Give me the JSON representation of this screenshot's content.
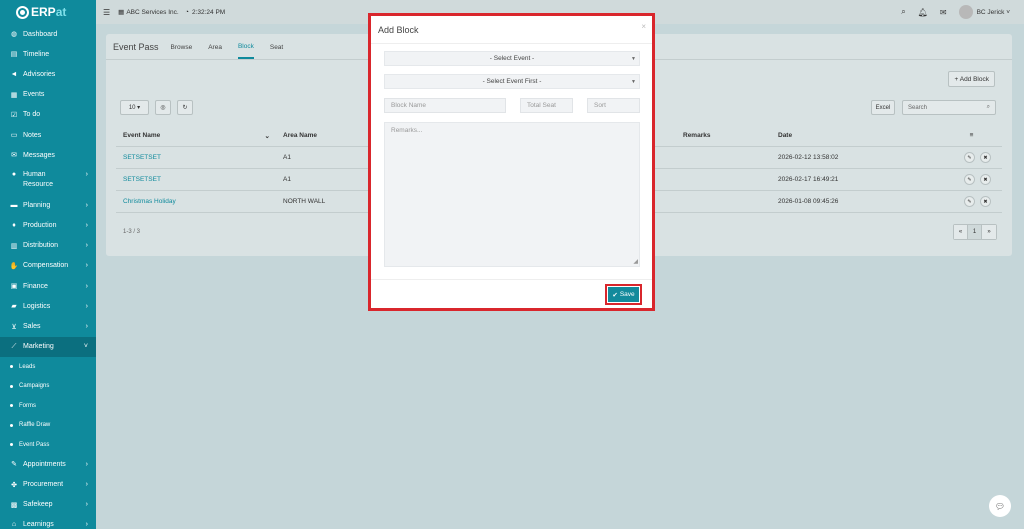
{
  "app": {
    "logo_main": "ERP",
    "logo_accent": "at"
  },
  "topbar": {
    "company": "ABC Services Inc.",
    "time": "2:32:24 PM",
    "user": "BC Jerick"
  },
  "sidebar": {
    "items": [
      {
        "label": "Dashboard",
        "icon": "dashboard-icon"
      },
      {
        "label": "Timeline",
        "icon": "timeline-icon"
      },
      {
        "label": "Advisories",
        "icon": "megaphone-icon"
      },
      {
        "label": "Events",
        "icon": "calendar-icon"
      },
      {
        "label": "To do",
        "icon": "checkbox-icon"
      },
      {
        "label": "Notes",
        "icon": "notes-icon"
      },
      {
        "label": "Messages",
        "icon": "envelope-icon"
      },
      {
        "label": "Human Resource",
        "icon": "users-icon"
      },
      {
        "label": "Planning",
        "icon": "planning-icon"
      },
      {
        "label": "Production",
        "icon": "production-icon"
      },
      {
        "label": "Distribution",
        "icon": "bank-icon"
      },
      {
        "label": "Compensation",
        "icon": "handshake-icon"
      },
      {
        "label": "Finance",
        "icon": "money-icon"
      },
      {
        "label": "Logistics",
        "icon": "truck-icon"
      },
      {
        "label": "Sales",
        "icon": "cart-icon"
      },
      {
        "label": "Marketing",
        "icon": "chart-icon"
      }
    ],
    "sub_items": [
      "Leads",
      "Campaigns",
      "Forms",
      "Raffle Draw",
      "Event Pass"
    ],
    "bottom_items": [
      {
        "label": "Appointments",
        "icon": "edit-icon"
      },
      {
        "label": "Procurement",
        "icon": "procurement-icon"
      },
      {
        "label": "Safekeep",
        "icon": "safe-icon"
      },
      {
        "label": "Learnings",
        "icon": "graduation-icon"
      }
    ]
  },
  "content": {
    "title": "Event Pass",
    "tabs": [
      "Browse",
      "Area",
      "Block",
      "Seat"
    ],
    "add_block": "+ Add Block",
    "page_size": "10",
    "excel": "Excel",
    "search_placeholder": "Search",
    "columns": [
      "Event Name",
      "Area Name",
      "Remarks",
      "Date"
    ],
    "rows": [
      {
        "event": "SETSETSET",
        "area": "A1",
        "date": "2026-02-12 13:58:02"
      },
      {
        "event": "SETSETSET",
        "area": "A1",
        "date": "2026-02-17 16:49:21"
      },
      {
        "event": "Christmas Holiday",
        "area": "NORTH WALL",
        "date": "2026-01-08 09:45:26"
      }
    ],
    "pager_info": "1-3 / 3",
    "page": "1"
  },
  "modal": {
    "title": "Add Block",
    "select_event": "- Select Event -",
    "select_event_first": "- Select Event First -",
    "block_name_placeholder": "Block Name",
    "total_seat_placeholder": "Total Seat",
    "sort_placeholder": "Sort",
    "remarks_placeholder": "Remarks...",
    "save": "Save"
  }
}
